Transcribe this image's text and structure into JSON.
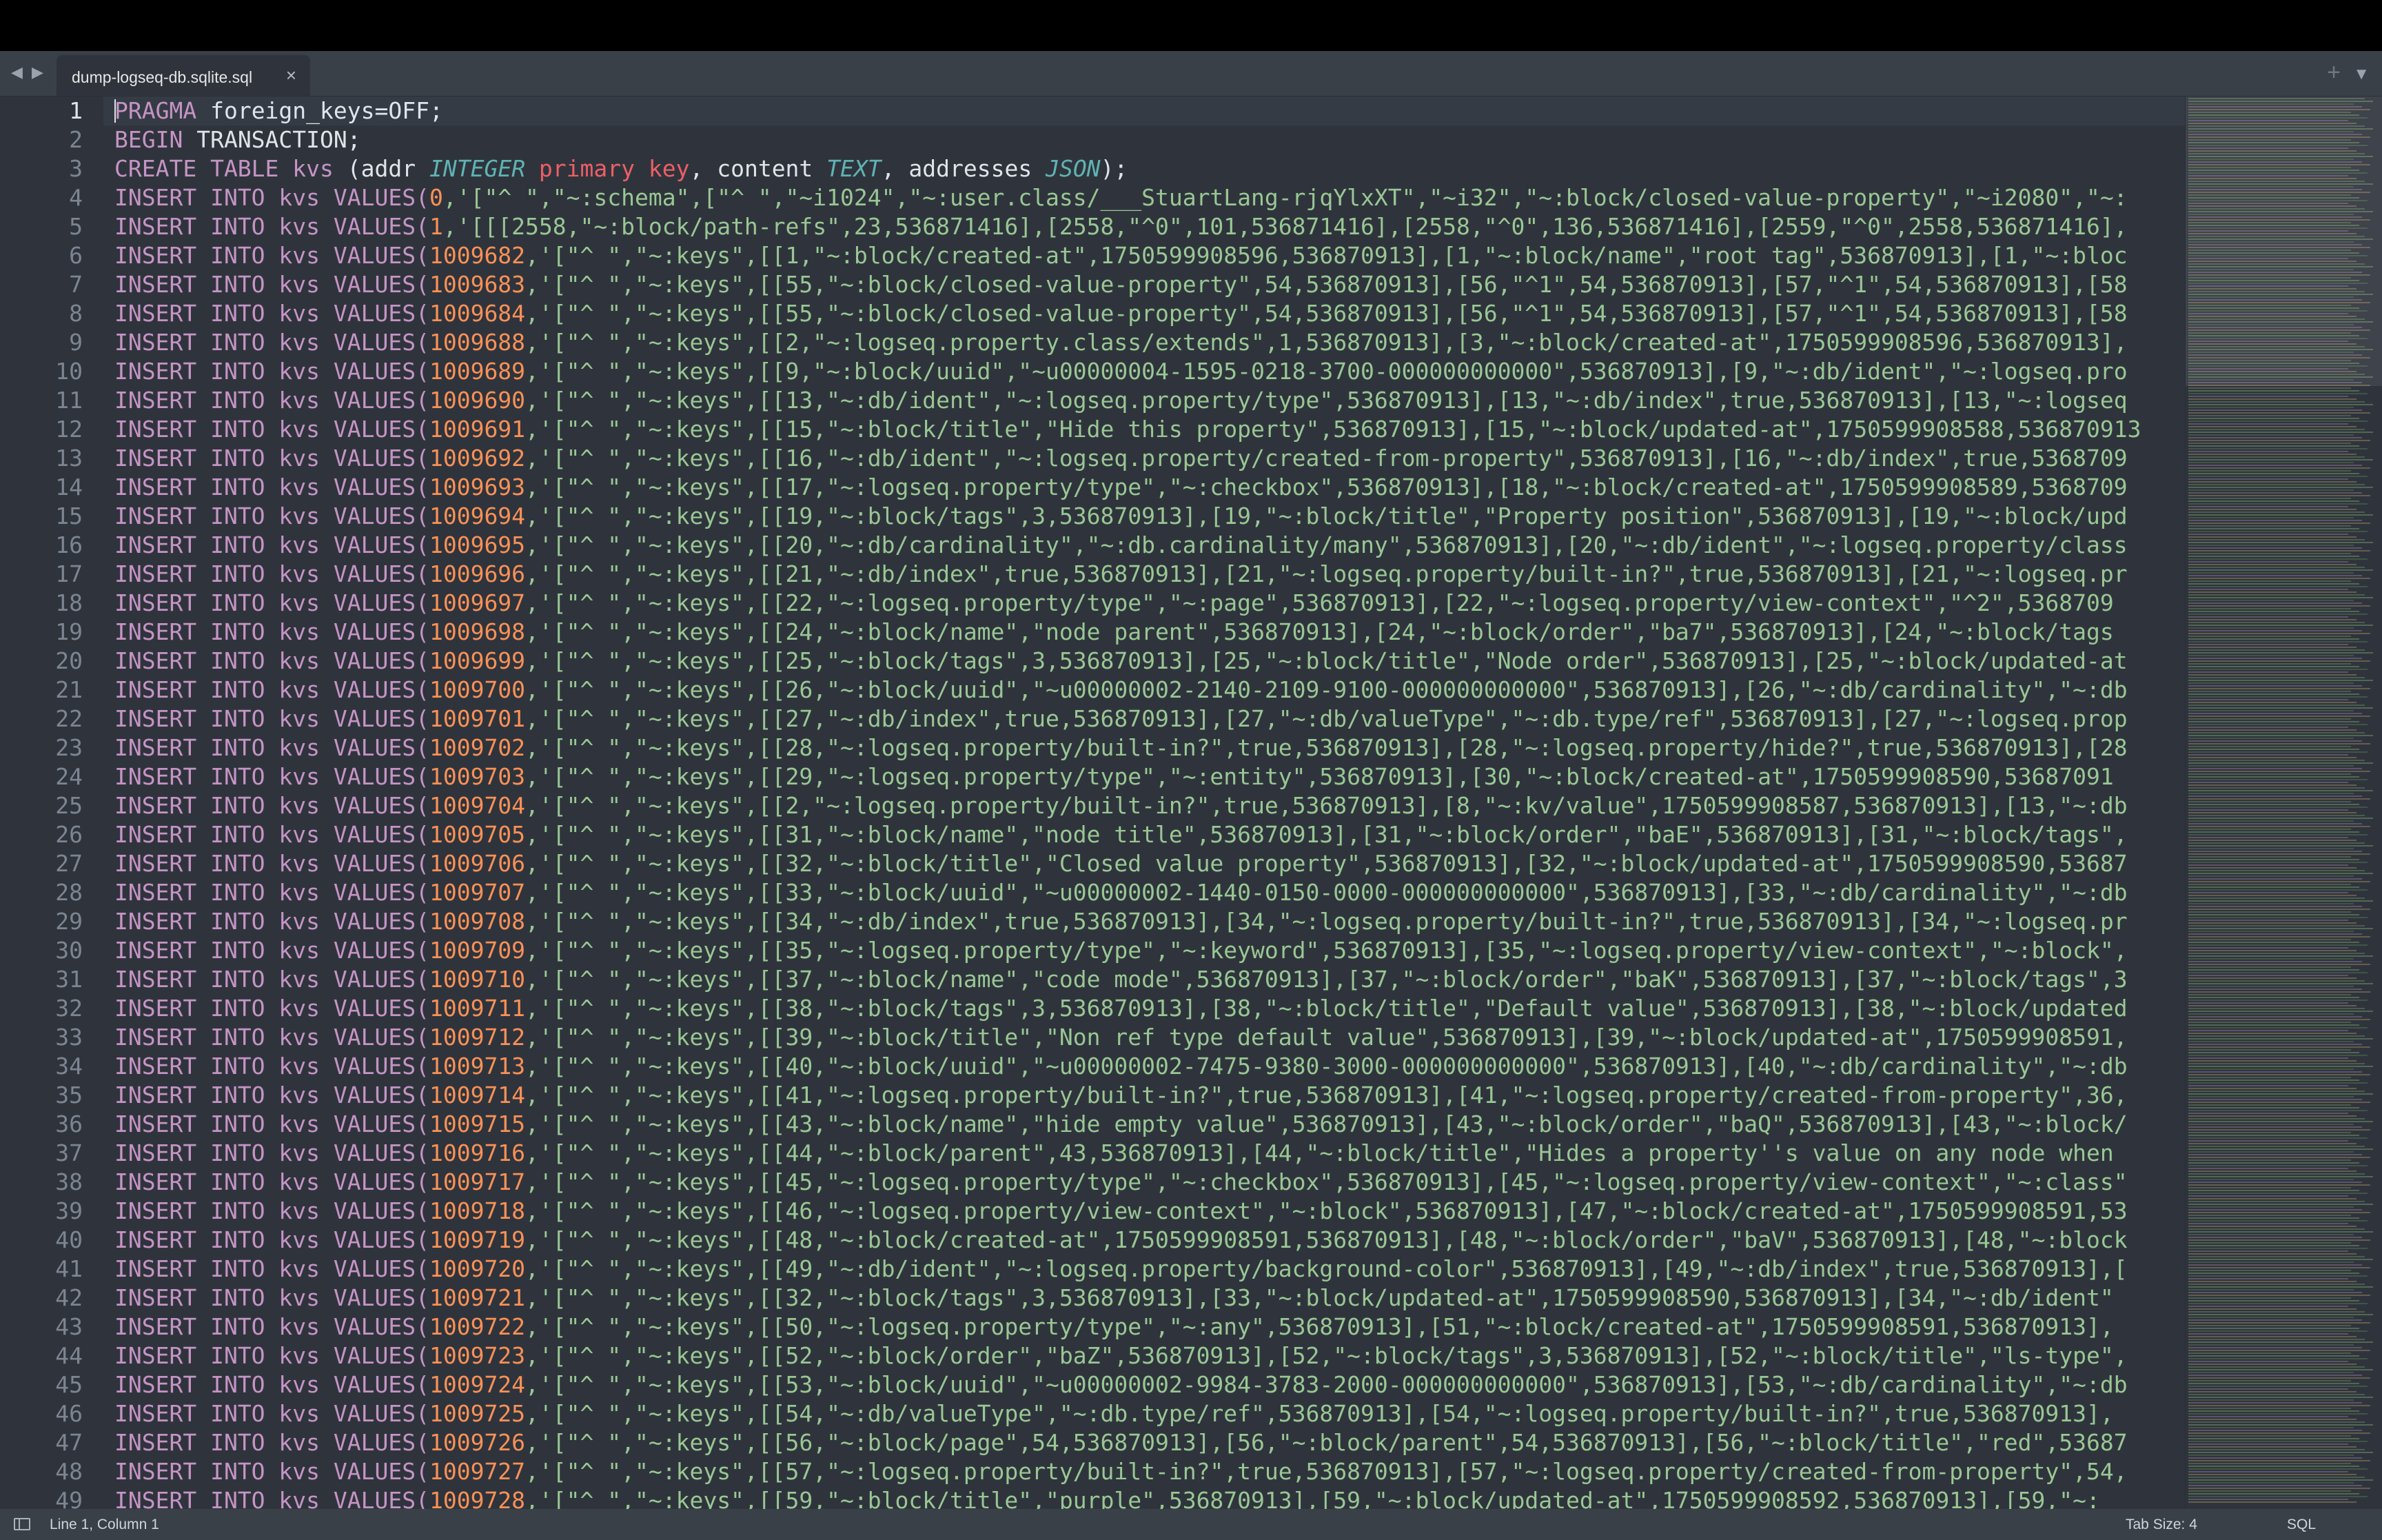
{
  "window": {
    "tab_title": "dump-logseq-db.sqlite.sql",
    "tab_close_glyph": "×",
    "nav_back_glyph": "◀",
    "nav_forward_glyph": "▶",
    "tab_add_glyph": "+",
    "tab_menu_glyph": "▼"
  },
  "editor": {
    "language": "SQL",
    "colors": {
      "background": "#2f343c",
      "keyword": "#c594c5",
      "number": "#f99157",
      "string": "#99c794",
      "type": "#5fb3b3"
    },
    "line_numbers": [
      "1",
      "2",
      "3",
      "4",
      "5",
      "6",
      "7",
      "8",
      "9",
      "10",
      "11",
      "12",
      "13",
      "14",
      "15",
      "16",
      "17",
      "18",
      "19",
      "20",
      "21",
      "22",
      "23",
      "24",
      "25",
      "26",
      "27",
      "28",
      "29",
      "30",
      "31",
      "32",
      "33",
      "34",
      "35",
      "36",
      "37",
      "38",
      "39",
      "40",
      "41",
      "42",
      "43",
      "44",
      "45",
      "46",
      "47",
      "48",
      "49"
    ],
    "header_lines": {
      "l1_kw": "PRAGMA",
      "l1_rest": " foreign_keys=OFF;",
      "l2_kw": "BEGIN",
      "l2_rest": " TRANSACTION;",
      "l3_kw": "CREATE TABLE",
      "l3_name": " kvs",
      "l3_a": " (addr ",
      "l3_int": "INTEGER",
      "l3_pk": " primary key",
      "l3_b": ", content ",
      "l3_text": "TEXT",
      "l3_c": ", addresses ",
      "l3_json": "JSON",
      "l3_d": ");"
    },
    "insert_prefix": "INSERT INTO kvs VALUES(",
    "insert_rows": [
      {
        "addr": "0",
        "data": ",'[\"^ \",\"~:schema\",[\"^ \",\"~i1024\",\"~:user.class/___StuartLang-rjqYlxXT\",\"~i32\",\"~:block/closed-value-property\",\"~i2080\",\"~:"
      },
      {
        "addr": "1",
        "data": ",'[[[2558,\"~:block/path-refs\",23,536871416],[2558,\"^0\",101,536871416],[2558,\"^0\",136,536871416],[2559,\"^0\",2558,536871416],"
      },
      {
        "addr": "1009682",
        "data": ",'[\"^ \",\"~:keys\",[[1,\"~:block/created-at\",1750599908596,536870913],[1,\"~:block/name\",\"root tag\",536870913],[1,\"~:bloc"
      },
      {
        "addr": "1009683",
        "data": ",'[\"^ \",\"~:keys\",[[55,\"~:block/closed-value-property\",54,536870913],[56,\"^1\",54,536870913],[57,\"^1\",54,536870913],[58"
      },
      {
        "addr": "1009684",
        "data": ",'[\"^ \",\"~:keys\",[[55,\"~:block/closed-value-property\",54,536870913],[56,\"^1\",54,536870913],[57,\"^1\",54,536870913],[58"
      },
      {
        "addr": "1009688",
        "data": ",'[\"^ \",\"~:keys\",[[2,\"~:logseq.property.class/extends\",1,536870913],[3,\"~:block/created-at\",1750599908596,536870913],"
      },
      {
        "addr": "1009689",
        "data": ",'[\"^ \",\"~:keys\",[[9,\"~:block/uuid\",\"~u00000004-1595-0218-3700-000000000000\",536870913],[9,\"~:db/ident\",\"~:logseq.pro"
      },
      {
        "addr": "1009690",
        "data": ",'[\"^ \",\"~:keys\",[[13,\"~:db/ident\",\"~:logseq.property/type\",536870913],[13,\"~:db/index\",true,536870913],[13,\"~:logseq"
      },
      {
        "addr": "1009691",
        "data": ",'[\"^ \",\"~:keys\",[[15,\"~:block/title\",\"Hide this property\",536870913],[15,\"~:block/updated-at\",1750599908588,536870913"
      },
      {
        "addr": "1009692",
        "data": ",'[\"^ \",\"~:keys\",[[16,\"~:db/ident\",\"~:logseq.property/created-from-property\",536870913],[16,\"~:db/index\",true,5368709"
      },
      {
        "addr": "1009693",
        "data": ",'[\"^ \",\"~:keys\",[[17,\"~:logseq.property/type\",\"~:checkbox\",536870913],[18,\"~:block/created-at\",1750599908589,5368709"
      },
      {
        "addr": "1009694",
        "data": ",'[\"^ \",\"~:keys\",[[19,\"~:block/tags\",3,536870913],[19,\"~:block/title\",\"Property position\",536870913],[19,\"~:block/upd"
      },
      {
        "addr": "1009695",
        "data": ",'[\"^ \",\"~:keys\",[[20,\"~:db/cardinality\",\"~:db.cardinality/many\",536870913],[20,\"~:db/ident\",\"~:logseq.property/class"
      },
      {
        "addr": "1009696",
        "data": ",'[\"^ \",\"~:keys\",[[21,\"~:db/index\",true,536870913],[21,\"~:logseq.property/built-in?\",true,536870913],[21,\"~:logseq.pr"
      },
      {
        "addr": "1009697",
        "data": ",'[\"^ \",\"~:keys\",[[22,\"~:logseq.property/type\",\"~:page\",536870913],[22,\"~:logseq.property/view-context\",\"^2\",5368709"
      },
      {
        "addr": "1009698",
        "data": ",'[\"^ \",\"~:keys\",[[24,\"~:block/name\",\"node parent\",536870913],[24,\"~:block/order\",\"ba7\",536870913],[24,\"~:block/tags"
      },
      {
        "addr": "1009699",
        "data": ",'[\"^ \",\"~:keys\",[[25,\"~:block/tags\",3,536870913],[25,\"~:block/title\",\"Node order\",536870913],[25,\"~:block/updated-at"
      },
      {
        "addr": "1009700",
        "data": ",'[\"^ \",\"~:keys\",[[26,\"~:block/uuid\",\"~u00000002-2140-2109-9100-000000000000\",536870913],[26,\"~:db/cardinality\",\"~:db"
      },
      {
        "addr": "1009701",
        "data": ",'[\"^ \",\"~:keys\",[[27,\"~:db/index\",true,536870913],[27,\"~:db/valueType\",\"~:db.type/ref\",536870913],[27,\"~:logseq.prop"
      },
      {
        "addr": "1009702",
        "data": ",'[\"^ \",\"~:keys\",[[28,\"~:logseq.property/built-in?\",true,536870913],[28,\"~:logseq.property/hide?\",true,536870913],[28"
      },
      {
        "addr": "1009703",
        "data": ",'[\"^ \",\"~:keys\",[[29,\"~:logseq.property/type\",\"~:entity\",536870913],[30,\"~:block/created-at\",1750599908590,53687091"
      },
      {
        "addr": "1009704",
        "data": ",'[\"^ \",\"~:keys\",[[2,\"~:logseq.property/built-in?\",true,536870913],[8,\"~:kv/value\",1750599908587,536870913],[13,\"~:db"
      },
      {
        "addr": "1009705",
        "data": ",'[\"^ \",\"~:keys\",[[31,\"~:block/name\",\"node title\",536870913],[31,\"~:block/order\",\"baE\",536870913],[31,\"~:block/tags\","
      },
      {
        "addr": "1009706",
        "data": ",'[\"^ \",\"~:keys\",[[32,\"~:block/title\",\"Closed value property\",536870913],[32,\"~:block/updated-at\",1750599908590,53687"
      },
      {
        "addr": "1009707",
        "data": ",'[\"^ \",\"~:keys\",[[33,\"~:block/uuid\",\"~u00000002-1440-0150-0000-000000000000\",536870913],[33,\"~:db/cardinality\",\"~:db"
      },
      {
        "addr": "1009708",
        "data": ",'[\"^ \",\"~:keys\",[[34,\"~:db/index\",true,536870913],[34,\"~:logseq.property/built-in?\",true,536870913],[34,\"~:logseq.pr"
      },
      {
        "addr": "1009709",
        "data": ",'[\"^ \",\"~:keys\",[[35,\"~:logseq.property/type\",\"~:keyword\",536870913],[35,\"~:logseq.property/view-context\",\"~:block\","
      },
      {
        "addr": "1009710",
        "data": ",'[\"^ \",\"~:keys\",[[37,\"~:block/name\",\"code mode\",536870913],[37,\"~:block/order\",\"baK\",536870913],[37,\"~:block/tags\",3"
      },
      {
        "addr": "1009711",
        "data": ",'[\"^ \",\"~:keys\",[[38,\"~:block/tags\",3,536870913],[38,\"~:block/title\",\"Default value\",536870913],[38,\"~:block/updated"
      },
      {
        "addr": "1009712",
        "data": ",'[\"^ \",\"~:keys\",[[39,\"~:block/title\",\"Non ref type default value\",536870913],[39,\"~:block/updated-at\",1750599908591,"
      },
      {
        "addr": "1009713",
        "data": ",'[\"^ \",\"~:keys\",[[40,\"~:block/uuid\",\"~u00000002-7475-9380-3000-000000000000\",536870913],[40,\"~:db/cardinality\",\"~:db"
      },
      {
        "addr": "1009714",
        "data": ",'[\"^ \",\"~:keys\",[[41,\"~:logseq.property/built-in?\",true,536870913],[41,\"~:logseq.property/created-from-property\",36,"
      },
      {
        "addr": "1009715",
        "data": ",'[\"^ \",\"~:keys\",[[43,\"~:block/name\",\"hide empty value\",536870913],[43,\"~:block/order\",\"baQ\",536870913],[43,\"~:block/"
      },
      {
        "addr": "1009716",
        "data": ",'[\"^ \",\"~:keys\",[[44,\"~:block/parent\",43,536870913],[44,\"~:block/title\",\"Hides a property''s value on any node when "
      },
      {
        "addr": "1009717",
        "data": ",'[\"^ \",\"~:keys\",[[45,\"~:logseq.property/type\",\"~:checkbox\",536870913],[45,\"~:logseq.property/view-context\",\"~:class\""
      },
      {
        "addr": "1009718",
        "data": ",'[\"^ \",\"~:keys\",[[46,\"~:logseq.property/view-context\",\"~:block\",536870913],[47,\"~:block/created-at\",1750599908591,53"
      },
      {
        "addr": "1009719",
        "data": ",'[\"^ \",\"~:keys\",[[48,\"~:block/created-at\",1750599908591,536870913],[48,\"~:block/order\",\"baV\",536870913],[48,\"~:block"
      },
      {
        "addr": "1009720",
        "data": ",'[\"^ \",\"~:keys\",[[49,\"~:db/ident\",\"~:logseq.property/background-color\",536870913],[49,\"~:db/index\",true,536870913],["
      },
      {
        "addr": "1009721",
        "data": ",'[\"^ \",\"~:keys\",[[32,\"~:block/tags\",3,536870913],[33,\"~:block/updated-at\",1750599908590,536870913],[34,\"~:db/ident\""
      },
      {
        "addr": "1009722",
        "data": ",'[\"^ \",\"~:keys\",[[50,\"~:logseq.property/type\",\"~:any\",536870913],[51,\"~:block/created-at\",1750599908591,536870913],"
      },
      {
        "addr": "1009723",
        "data": ",'[\"^ \",\"~:keys\",[[52,\"~:block/order\",\"baZ\",536870913],[52,\"~:block/tags\",3,536870913],[52,\"~:block/title\",\"ls-type\","
      },
      {
        "addr": "1009724",
        "data": ",'[\"^ \",\"~:keys\",[[53,\"~:block/uuid\",\"~u00000002-9984-3783-2000-000000000000\",536870913],[53,\"~:db/cardinality\",\"~:db"
      },
      {
        "addr": "1009725",
        "data": ",'[\"^ \",\"~:keys\",[[54,\"~:db/valueType\",\"~:db.type/ref\",536870913],[54,\"~:logseq.property/built-in?\",true,536870913],"
      },
      {
        "addr": "1009726",
        "data": ",'[\"^ \",\"~:keys\",[[56,\"~:block/page\",54,536870913],[56,\"~:block/parent\",54,536870913],[56,\"~:block/title\",\"red\",53687"
      },
      {
        "addr": "1009727",
        "data": ",'[\"^ \",\"~:keys\",[[57,\"~:logseq.property/built-in?\",true,536870913],[57,\"~:logseq.property/created-from-property\",54,"
      },
      {
        "addr": "1009728",
        "data": ",'[\"^ \",\"~:keys\",[[59,\"~:block/title\",\"purple\",536870913],[59,\"~:block/updated-at\",1750599908592,536870913],[59,\"~:"
      }
    ]
  },
  "status_bar": {
    "position": "Line 1, Column 1",
    "tab_size": "Tab Size: 4",
    "syntax": "SQL"
  }
}
